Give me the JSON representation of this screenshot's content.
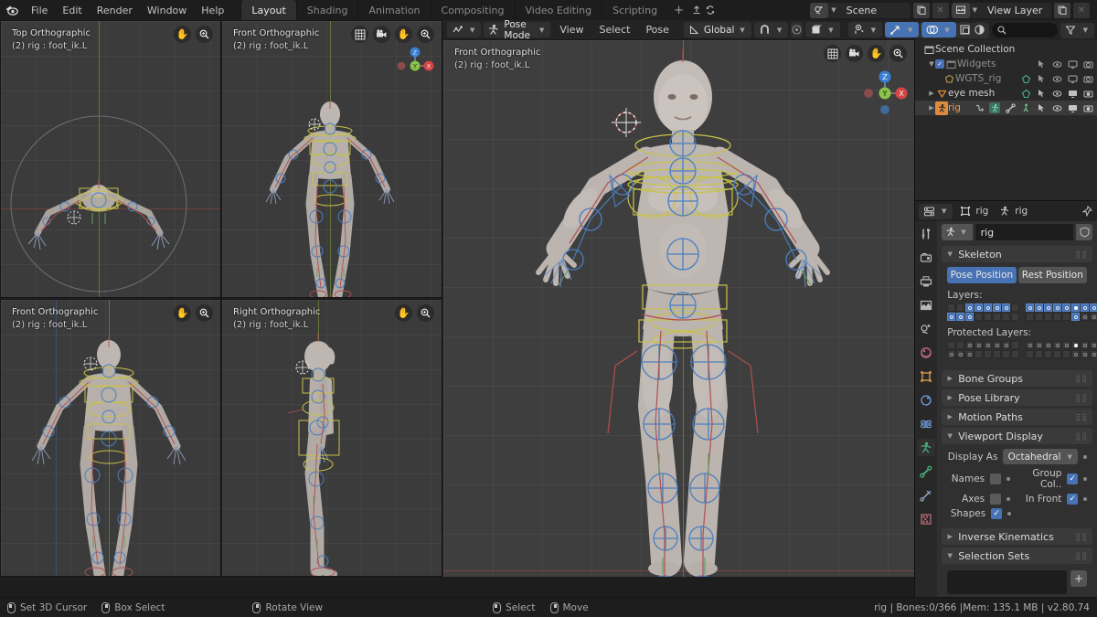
{
  "app": {
    "title": "Blender",
    "version_status": "rig | Bones:0/366  |Mem: 135.1 MB | v2.80.74"
  },
  "topbar": {
    "logo_icon": "blender-logo-icon",
    "menus": [
      "File",
      "Edit",
      "Render",
      "Window",
      "Help"
    ],
    "workspace_tabs": [
      {
        "label": "Layout",
        "active": true
      },
      {
        "label": "Shading",
        "active": false
      },
      {
        "label": "Animation",
        "active": false
      },
      {
        "label": "Compositing",
        "active": false
      },
      {
        "label": "Video Editing",
        "active": false
      },
      {
        "label": "Scripting",
        "active": false
      }
    ],
    "add_workspace_label": "+",
    "scene": {
      "icon": "scene-icon",
      "name": "Scene",
      "new_icon": "duplicate-icon",
      "unlink_icon": "x-icon"
    },
    "view_layer": {
      "icon": "view-layer-icon",
      "name": "View Layer",
      "new_icon": "duplicate-icon",
      "unlink_icon": "x-icon"
    }
  },
  "quad_views": [
    {
      "name": "Top Orthographic",
      "object": "(2) rig : foot_ik.L",
      "tools": [
        "hand-icon",
        "zoom-icon"
      ]
    },
    {
      "name": "Front Orthographic",
      "object": "(2) rig : foot_ik.L",
      "tools": [
        "grid-icon",
        "camera-icon",
        "hand-icon",
        "zoom-icon"
      ]
    },
    {
      "name": "Front Orthographic",
      "object": "(2) rig : foot_ik.L",
      "tools": [
        "hand-icon",
        "zoom-icon"
      ]
    },
    {
      "name": "Right Orthographic",
      "object": "(2) rig : foot_ik.L",
      "tools": [
        "hand-icon",
        "zoom-icon"
      ]
    }
  ],
  "main_viewport": {
    "header": {
      "editor_type_icon": "editor-type-icon",
      "mode_icon": "pose-mode-icon",
      "mode": "Pose Mode",
      "menus": [
        "View",
        "Select",
        "Pose"
      ],
      "transform_orientation_icon": "orientation-icon",
      "transform_orientation": "Global",
      "snap_icon": "magnet-icon",
      "proportional_icon": "proportional-edit-icon",
      "pivot_icon": "pivot-point-icon",
      "visibility_icon": "visibility-icon",
      "gizmo_icon": "gizmo-icon",
      "overlays_icon": "overlays-icon",
      "xray_icon": "xray-icon",
      "shading_icon": "shading-icon"
    },
    "label_name": "Front Orthographic",
    "label_object": "(2) rig : foot_ik.L",
    "tools": [
      "grid-icon",
      "camera-icon",
      "hand-icon",
      "zoom-icon"
    ],
    "gizmo_axes": [
      {
        "label": "Z",
        "color": "#3b7fd4"
      },
      {
        "label": "Y",
        "color": "#8bc34a"
      },
      {
        "label": "X",
        "color": "#d64545"
      }
    ]
  },
  "outliner": {
    "display_mode_icon": "outliner-display-icon",
    "filter_icon": "filter-dropdown-icon",
    "search_icon": "search-icon",
    "search_value": "",
    "search_placeholder": "",
    "funnel_icon": "funnel-icon",
    "rows": [
      {
        "label": "Scene Collection",
        "indent": 0,
        "icon": "collection-icon",
        "expand": "",
        "checkbox": false,
        "dim": false,
        "selected": false,
        "icons": [
          "cursor-icon",
          "eye-icon",
          "screen-icon",
          "camera-icon"
        ],
        "extra_icons": []
      },
      {
        "label": "Widgets",
        "indent": 1,
        "icon": "collection-icon",
        "expand": "down",
        "checkbox": true,
        "dim": true,
        "selected": false,
        "icons": [
          "cursor-icon",
          "eye-icon",
          "screen-icon",
          "camera-icon"
        ],
        "extra_icons": []
      },
      {
        "label": "WGTS_rig",
        "indent": 2,
        "icon": "mesh-data-icon",
        "expand": "",
        "checkbox": false,
        "dim": true,
        "selected": false,
        "icons": [
          "cursor-icon",
          "eye-icon",
          "screen-icon",
          "camera-icon"
        ],
        "extra_icons": [
          "mesh-green-icon"
        ]
      },
      {
        "label": "eye mesh",
        "indent": 1,
        "icon": "mesh-object-icon",
        "expand": "right",
        "checkbox": false,
        "dim": false,
        "selected": false,
        "icons": [
          "cursor-icon",
          "eye-icon",
          "screen-icon",
          "camera-icon"
        ],
        "extra_icons": [
          "mesh-green-icon"
        ]
      },
      {
        "label": "rig",
        "indent": 1,
        "icon": "armature-icon",
        "expand": "right",
        "checkbox": false,
        "dim": false,
        "selected": true,
        "icons": [
          "cursor-icon",
          "eye-icon",
          "screen-icon",
          "camera-icon"
        ],
        "extra_icons": [
          "modifier-icon",
          "armature-data-icon",
          "bone-icon",
          "pose-icon"
        ]
      }
    ]
  },
  "properties": {
    "editor_icon": "properties-editor-icon",
    "breadcrumb": [
      {
        "icon": "object-icon",
        "label": "rig"
      },
      {
        "icon": "armature-data-icon",
        "label": "rig"
      }
    ],
    "pin_icon": "pin-icon",
    "tabs": [
      {
        "name": "tool-tab",
        "icon": "tool-icon",
        "active": false
      },
      {
        "name": "render-tab",
        "icon": "render-icon",
        "active": false
      },
      {
        "name": "output-tab",
        "icon": "output-icon",
        "active": false
      },
      {
        "name": "view-layer-tab",
        "icon": "view-layer-icon",
        "active": false
      },
      {
        "name": "scene-tab",
        "icon": "scene-icon",
        "active": false
      },
      {
        "name": "world-tab",
        "icon": "world-icon",
        "active": false
      },
      {
        "name": "object-tab",
        "icon": "object-icon",
        "active": false
      },
      {
        "name": "modifier-tab",
        "icon": "modifier-icon",
        "active": false
      },
      {
        "name": "physics-tab",
        "icon": "physics-icon",
        "active": false
      },
      {
        "name": "armature-data-tab",
        "icon": "armature-data-icon",
        "active": true
      },
      {
        "name": "bone-tab",
        "icon": "bone-icon",
        "active": false
      },
      {
        "name": "bone-constraint-tab",
        "icon": "bone-constraint-icon",
        "active": false
      },
      {
        "name": "texture-tab",
        "icon": "texture-icon",
        "active": false
      }
    ],
    "datablock": {
      "icon": "armature-data-icon",
      "value": "rig",
      "shield_icon": "fake-user-icon"
    },
    "panels": {
      "skeleton": {
        "label": "Skeleton",
        "expanded": true,
        "pose_position_label": "Pose Position",
        "rest_position_label": "Rest Position",
        "pose_position_active": true,
        "layers_label": "Layers:",
        "protected_layers_label": "Protected Layers:",
        "layers": {
          "block1_row1": [
            0,
            0,
            1,
            1,
            1,
            1,
            1,
            0
          ],
          "block1_row2": [
            1,
            1,
            1,
            0,
            0,
            0,
            0,
            0
          ],
          "block2_row1": [
            1,
            1,
            1,
            1,
            1,
            2,
            1,
            1
          ],
          "block2_row2": [
            0,
            0,
            0,
            0,
            0,
            1,
            0,
            0,
            0
          ]
        }
      },
      "bone_groups": {
        "label": "Bone Groups",
        "expanded": false
      },
      "pose_library": {
        "label": "Pose Library",
        "expanded": false
      },
      "motion_paths": {
        "label": "Motion Paths",
        "expanded": false
      },
      "viewport_display": {
        "label": "Viewport Display",
        "expanded": true,
        "display_as_label": "Display As",
        "display_as_value": "Octahedral",
        "names_label": "Names",
        "names_checked": false,
        "axes_label": "Axes",
        "axes_checked": false,
        "shapes_label": "Shapes",
        "shapes_checked": true,
        "group_colors_label": "Group Col..",
        "group_colors_checked": true,
        "in_front_label": "In Front",
        "in_front_checked": true
      },
      "inverse_kinematics": {
        "label": "Inverse Kinematics",
        "expanded": false
      },
      "selection_sets": {
        "label": "Selection Sets",
        "expanded": true,
        "add_label": "+"
      }
    }
  },
  "statusbar": {
    "items": [
      {
        "mouse": "left",
        "label": "Set 3D Cursor"
      },
      {
        "mouse": "right",
        "label": "Box Select"
      },
      {
        "mouse": "middle",
        "label": "Rotate View"
      },
      {
        "mouse": "left",
        "label": "Select"
      },
      {
        "mouse": "right",
        "label": "Move"
      }
    ],
    "status_text": "rig | Bones:0/366  |Mem: 135.1 MB | v2.80.74"
  },
  "colors": {
    "accent_blue": "#4772b3",
    "bone_circle": "#4a7fc1",
    "bone_yellow": "#c9c24a",
    "bone_red": "#b14f4f",
    "selected_orange": "#f0883c",
    "background": "#1d1d1d",
    "viewport": "#3e3e3e"
  }
}
